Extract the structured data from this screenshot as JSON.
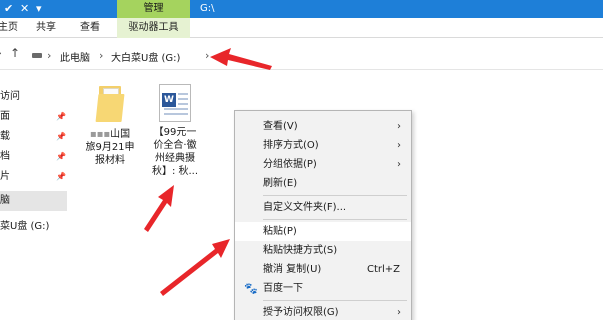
{
  "titlebar": {
    "manage_tab": "管理",
    "drive_path": "G:\\"
  },
  "ribbon": {
    "tabs": [
      "主页",
      "共享",
      "查看",
      "驱动器工具"
    ]
  },
  "address": {
    "crumbs": [
      "此电脑",
      "大白菜U盘 (G:)"
    ]
  },
  "nav": {
    "items": [
      "访问",
      "面",
      "载",
      "档",
      "片",
      "脑",
      "菜U盘 (G:)"
    ]
  },
  "files": [
    {
      "name": "山国\n旅9月21申\n报材料",
      "name_prefix": "▪▪▪",
      "type": "folder"
    },
    {
      "name": "【99元一\n价全合·徽\n州经典摄\n秋】: 秋...",
      "type": "word-doc"
    }
  ],
  "context_menu": {
    "items": [
      {
        "label": "查看(V)",
        "submenu": true
      },
      {
        "label": "排序方式(O)",
        "submenu": true
      },
      {
        "label": "分组依据(P)",
        "submenu": true
      },
      {
        "label": "刷新(E)"
      },
      {
        "label": "自定义文件夹(F)..."
      },
      {
        "label": "粘贴(P)"
      },
      {
        "label": "粘贴快捷方式(S)"
      },
      {
        "label": "撤消 复制(U)",
        "shortcut": "Ctrl+Z"
      },
      {
        "label": "百度一下",
        "icon": "baidu-paw-icon"
      },
      {
        "label": "授予访问权限(G)",
        "submenu": true
      }
    ]
  },
  "icons": {
    "arrow_color": "#e8262a",
    "accent_titlebar": "#1e7fd8",
    "drive_tools_tab": "#a5d35e"
  }
}
